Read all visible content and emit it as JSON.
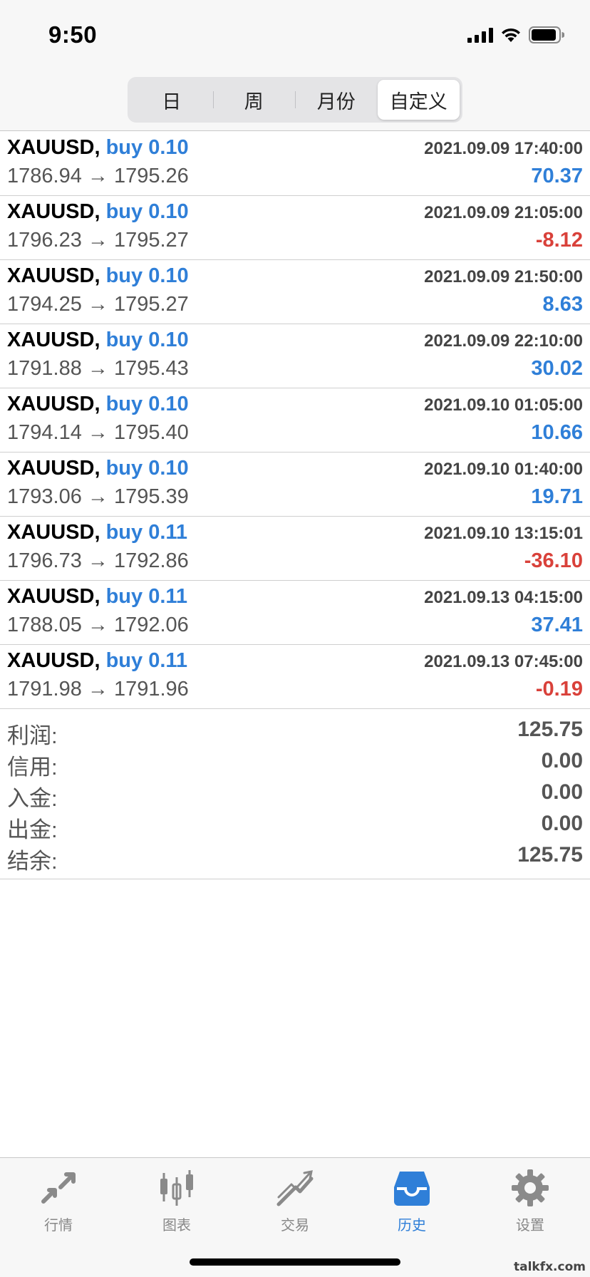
{
  "status_bar": {
    "time": "9:50"
  },
  "tabs": [
    {
      "label": "日",
      "active": false
    },
    {
      "label": "周",
      "active": false
    },
    {
      "label": "月份",
      "active": false
    },
    {
      "label": "自定义",
      "active": true
    }
  ],
  "trades": [
    {
      "symbol": "XAUUSD,",
      "side": "buy 0.10",
      "date": "2021.09.09 17:40:00",
      "prices": "1786.94 → 1795.26",
      "profit": "70.37",
      "positive": true
    },
    {
      "symbol": "XAUUSD,",
      "side": "buy 0.10",
      "date": "2021.09.09 21:05:00",
      "prices": "1796.23 → 1795.27",
      "profit": "-8.12",
      "positive": false
    },
    {
      "symbol": "XAUUSD,",
      "side": "buy 0.10",
      "date": "2021.09.09 21:50:00",
      "prices": "1794.25 → 1795.27",
      "profit": "8.63",
      "positive": true
    },
    {
      "symbol": "XAUUSD,",
      "side": "buy 0.10",
      "date": "2021.09.09 22:10:00",
      "prices": "1791.88 → 1795.43",
      "profit": "30.02",
      "positive": true
    },
    {
      "symbol": "XAUUSD,",
      "side": "buy 0.10",
      "date": "2021.09.10 01:05:00",
      "prices": "1794.14 → 1795.40",
      "profit": "10.66",
      "positive": true
    },
    {
      "symbol": "XAUUSD,",
      "side": "buy 0.10",
      "date": "2021.09.10 01:40:00",
      "prices": "1793.06 → 1795.39",
      "profit": "19.71",
      "positive": true
    },
    {
      "symbol": "XAUUSD,",
      "side": "buy 0.11",
      "date": "2021.09.10 13:15:01",
      "prices": "1796.73 → 1792.86",
      "profit": "-36.10",
      "positive": false
    },
    {
      "symbol": "XAUUSD,",
      "side": "buy 0.11",
      "date": "2021.09.13 04:15:00",
      "prices": "1788.05 → 1792.06",
      "profit": "37.41",
      "positive": true
    },
    {
      "symbol": "XAUUSD,",
      "side": "buy 0.11",
      "date": "2021.09.13 07:45:00",
      "prices": "1791.98 → 1791.96",
      "profit": "-0.19",
      "positive": false
    }
  ],
  "summary": [
    {
      "label": "利润:",
      "value": "125.75"
    },
    {
      "label": "信用:",
      "value": "0.00"
    },
    {
      "label": "入金:",
      "value": "0.00"
    },
    {
      "label": "出金:",
      "value": "0.00"
    },
    {
      "label": "结余:",
      "value": "125.75"
    }
  ],
  "tabbar": [
    {
      "label": "行情",
      "icon": "quotes-arrows-icon",
      "active": false
    },
    {
      "label": "图表",
      "icon": "candlestick-chart-icon",
      "active": false
    },
    {
      "label": "交易",
      "icon": "trade-chart-icon",
      "active": false
    },
    {
      "label": "历史",
      "icon": "history-inbox-icon",
      "active": true
    },
    {
      "label": "设置",
      "icon": "gear-icon",
      "active": false
    }
  ],
  "watermark": "talkfx.com",
  "colors": {
    "accent_blue": "#2f7fd8",
    "loss_red": "#d9413a",
    "inactive_gray": "#888888"
  }
}
